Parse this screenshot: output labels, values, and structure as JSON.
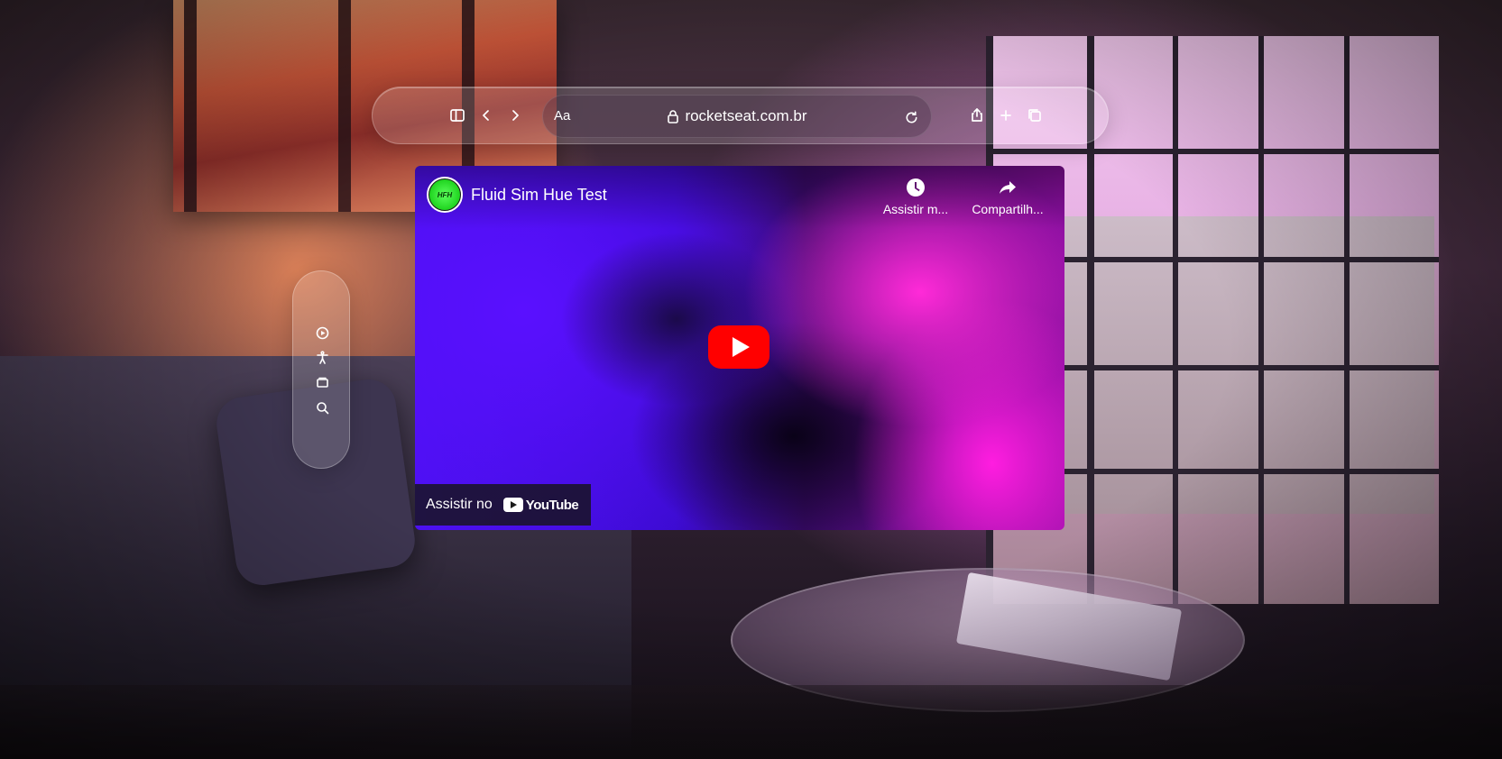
{
  "toolbar": {
    "sidebar_icon": "sidebar-icon",
    "back_icon": "chevron-left-icon",
    "forward_icon": "chevron-right-icon",
    "reader_label": "Aa",
    "url": "rocketseat.com.br",
    "reload_icon": "reload-icon",
    "share_icon": "share-icon",
    "new_tab_icon": "plus-icon",
    "tabs_icon": "tabs-icon"
  },
  "ornament": {
    "items": [
      "play-circle-icon",
      "accessibility-icon",
      "window-icon",
      "search-icon"
    ]
  },
  "video": {
    "channel_avatar_text": "HFH",
    "title": "Fluid Sim Hue Test",
    "actions": [
      {
        "label": "Assistir m...",
        "icon": "clock-icon"
      },
      {
        "label": "Compartilh...",
        "icon": "share-arrow-icon"
      }
    ],
    "play_icon": "play-icon",
    "watch_on_label": "Assistir no",
    "youtube_logo_text": "YouTube"
  },
  "colors": {
    "youtube_red": "#ff0000",
    "glass": "rgba(255,255,255,0.16)"
  }
}
